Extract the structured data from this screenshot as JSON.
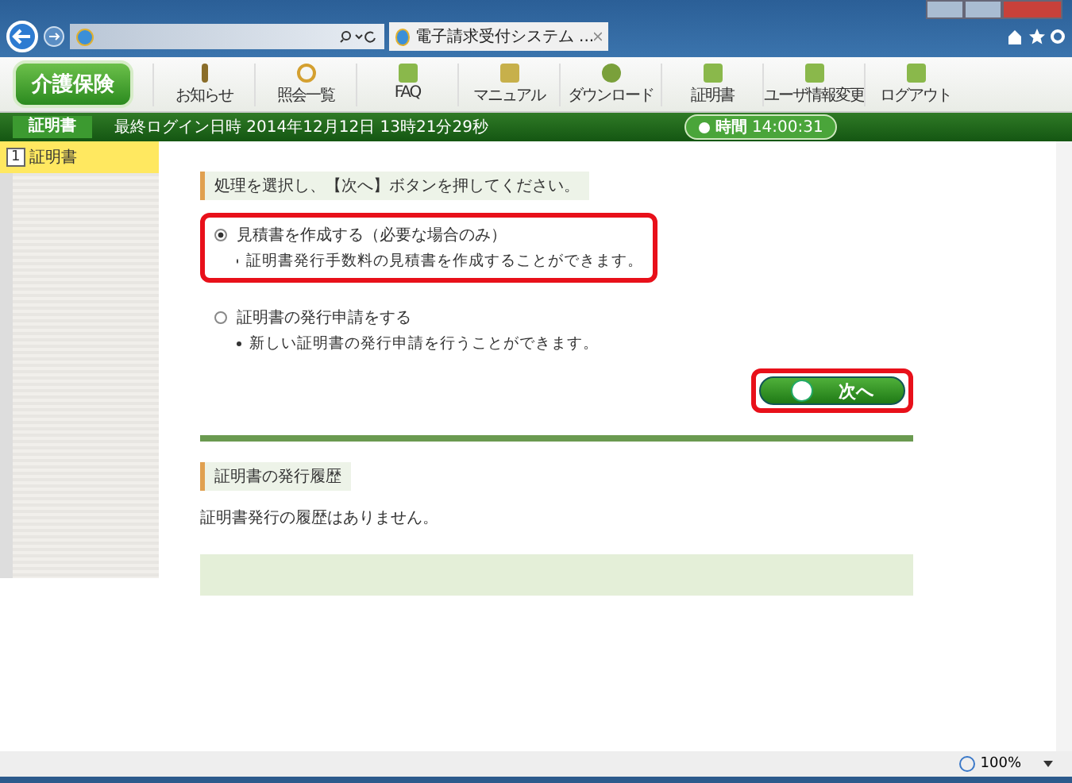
{
  "browser": {
    "tab_title": "電子請求受付システム ...",
    "zoom": "100%"
  },
  "app": {
    "logo": "介護保険",
    "toolbar": [
      {
        "label": "お知らせ"
      },
      {
        "label": "照会一覧"
      },
      {
        "label": "FAQ"
      },
      {
        "label": "マニュアル"
      },
      {
        "label": "ダウンロード"
      },
      {
        "label": "証明書"
      },
      {
        "label": "ユーザ情報変更"
      },
      {
        "label": "ログアウト"
      }
    ],
    "header": {
      "section": "証明書",
      "last_login": "最終ログイン日時 2014年12月12日 13時21分29秒",
      "timer_label": "時間",
      "timer": "14:00:31"
    }
  },
  "sidebar": {
    "items": [
      {
        "number": "1",
        "label": "証明書",
        "selected": true
      }
    ]
  },
  "main": {
    "instruction": "処理を選択し、【次へ】ボタンを押してください。",
    "options": [
      {
        "label": "見積書を作成する（必要な場合のみ）",
        "description": "証明書発行手数料の見積書を作成することができます。",
        "selected": true,
        "highlighted": true
      },
      {
        "label": "証明書の発行申請をする",
        "description": "新しい証明書の発行申請を行うことができます。",
        "selected": false,
        "highlighted": false
      }
    ],
    "next_button": {
      "label": "次へ",
      "highlighted": true
    },
    "history_title": "証明書の発行履歴",
    "history_message": "証明書発行の履歴はありません。"
  }
}
